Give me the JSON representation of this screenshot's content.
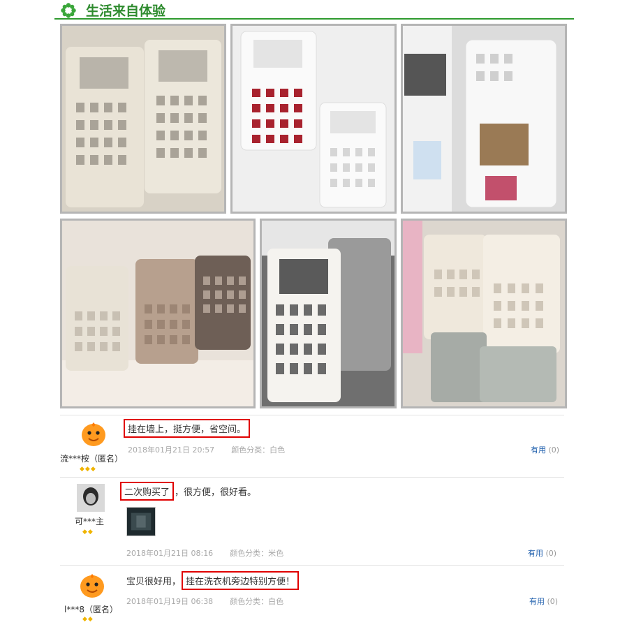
{
  "section": {
    "title": "生活来自体验",
    "icon": "green-flower-icon",
    "accent": "#2e8b2e"
  },
  "photos": [
    {
      "name": "photo-beige-baskets-window",
      "tone": "#ded6c8"
    },
    {
      "name": "photo-white-baskets-wall",
      "tone": "#eeeeee"
    },
    {
      "name": "photo-basket-washing-machine",
      "tone": "#e6e6e6"
    },
    {
      "name": "photo-three-colored-baskets",
      "tone": "#d8cfc6"
    },
    {
      "name": "photo-baskets-bathroom-tiles",
      "tone": "#8a8a8a"
    },
    {
      "name": "photo-stacked-baskets-corner",
      "tone": "#e4ddd4"
    }
  ],
  "reviews": [
    {
      "username": "流***桉（匿名）",
      "rank": "◆◆◆",
      "text_before": "",
      "text_highlight": "挂在墙上，挺方便，省空间。",
      "text_after": "",
      "date": "2018年01月21日 20:57",
      "color": "颜色分类：白色",
      "useful_label": "有用",
      "useful_count": "(0)"
    },
    {
      "username": "可***主",
      "rank": "◆◆",
      "text_before": "",
      "text_highlight": "二次购买了",
      "text_after": "，很方便，很好看。",
      "date": "2018年01月21日 08:16",
      "color": "颜色分类：米色",
      "useful_label": "有用",
      "useful_count": "(0)"
    },
    {
      "username": "l***8（匿名）",
      "rank": "◆◆",
      "text_before": "宝贝很好用，",
      "text_highlight": "挂在洗衣机旁边特别方便！",
      "text_after": "",
      "date": "2018年01月19日 06:38",
      "color": "颜色分类：白色",
      "useful_label": "有用",
      "useful_count": "(0)"
    }
  ]
}
